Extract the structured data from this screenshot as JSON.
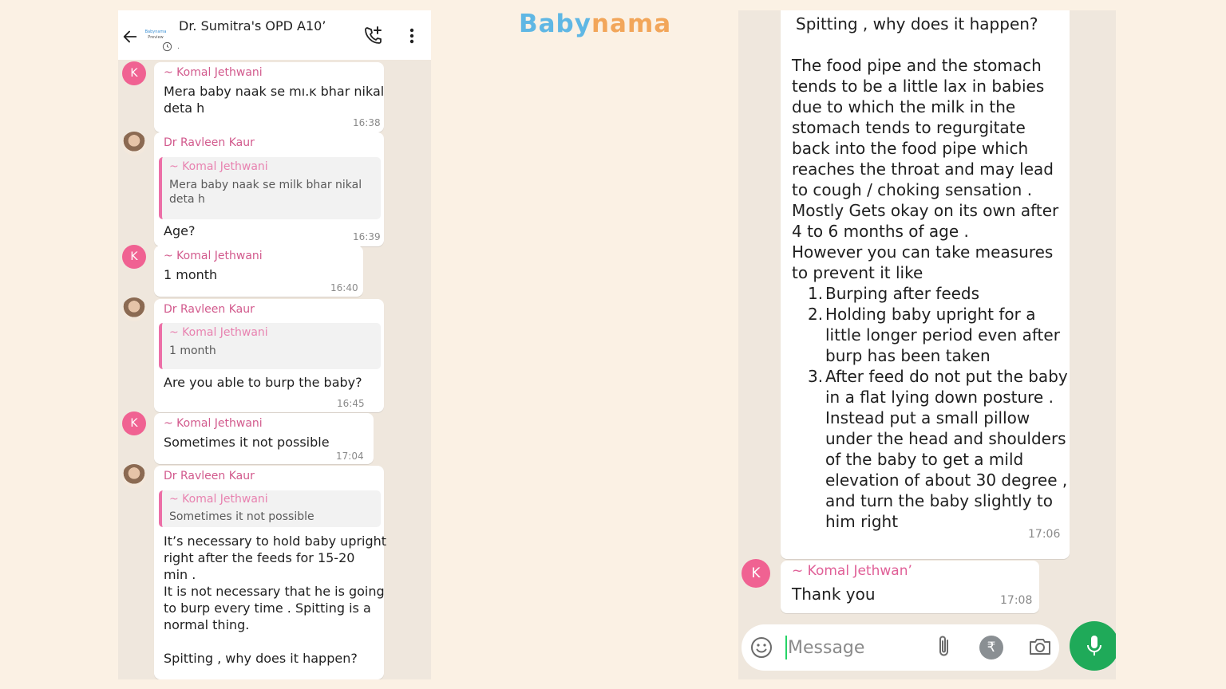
{
  "brand": {
    "part1": "Baby",
    "part2": "nama"
  },
  "left_chat": {
    "header": {
      "title": "Dr. Sumitra's OPD A10’",
      "avatar_text": "Babynama",
      "avatar_sub": "Preview",
      "subtitle": "."
    },
    "messages": [
      {
        "avatar": "K",
        "sender": "~ Komal Jethwani",
        "lines": [
          "Mera baby naak se mı.ĸ bhar nikal",
          "deta h"
        ],
        "time": "16:38"
      },
      {
        "sender": "Dr Ravleen Kaur",
        "quote_sender": "~ Komal Jethwani",
        "quote_lines": [
          "Mera baby naak se milk bhar nikal",
          "deta h"
        ],
        "lines": [
          "Age?"
        ],
        "time": "16:39"
      },
      {
        "avatar": "K",
        "sender": "~ Komal Jethwani",
        "lines": [
          "1 month"
        ],
        "time": "16:40"
      },
      {
        "sender": "Dr Ravleen Kaur",
        "quote_sender": "~ Komal Jethwani",
        "quote_lines": [
          "1 month"
        ],
        "lines": [
          "Are you able to burp the baby?"
        ],
        "time": "16:45"
      },
      {
        "avatar": "K",
        "sender": "~ Komal Jethwani",
        "lines": [
          "Sometimes it not possible"
        ],
        "time": "17:04"
      },
      {
        "sender": "Dr Ravleen Kaur",
        "quote_sender": "~ Komal Jethwani",
        "quote_lines": [
          "Sometimes it not possible"
        ],
        "lines": [
          "It’s necessary to hold baby upright",
          "right after the feeds for 15-20",
          "min .",
          "It is not necessary that he is going",
          "to burp every time . Spitting  is a",
          "normal thing.",
          "",
          " Spitting , why does it happen?"
        ]
      }
    ]
  },
  "right_chat": {
    "long_message": {
      "heading": "Spitting , why does it happen?",
      "body": [
        "The food pipe and the stomach",
        "tends to be a little lax in babies",
        "due to which the milk in the",
        "stomach tends to regurgitate",
        "back into the food pipe which",
        "reaches the throat and may lead",
        "to cough / choking sensation .",
        "Mostly Gets okay on its own after",
        "4 to 6 months of age .",
        "However you can take measures",
        "to prevent it like"
      ],
      "list": [
        {
          "num": "1.",
          "lines": [
            "Burping after feeds"
          ]
        },
        {
          "num": "2.",
          "lines": [
            "Holding baby upright for a",
            "little longer period even after",
            "burp has been taken"
          ]
        },
        {
          "num": "3.",
          "lines": [
            "After feed do not put the baby",
            "in a flat lying down posture .",
            "Instead put a small pillow",
            "under the head and shoulders",
            "of the baby to get a mild",
            "elevation of about 30 degree ,",
            "and turn the baby slightly to",
            "him right"
          ]
        }
      ],
      "time": "17:06"
    },
    "reply": {
      "avatar": "K",
      "sender": "~ Komal Jethwan’",
      "text": "Thank you",
      "time": "17:08"
    },
    "input": {
      "placeholder": "Message",
      "rupee": "₹"
    }
  },
  "colors": {
    "page_bg": "#fbf1e4",
    "chat_bg": "#efe7dd",
    "sender_pink": "#d25a8d",
    "avatar_pink": "#f06292",
    "mic_green": "#1faa59",
    "logo_blue": "#5fb7e4",
    "logo_orange": "#f2a65a"
  },
  "icons": [
    "back-arrow-icon",
    "add-call-icon",
    "menu-dots-icon",
    "emoji-icon",
    "attach-icon",
    "rupee-icon",
    "camera-icon",
    "mic-icon"
  ]
}
